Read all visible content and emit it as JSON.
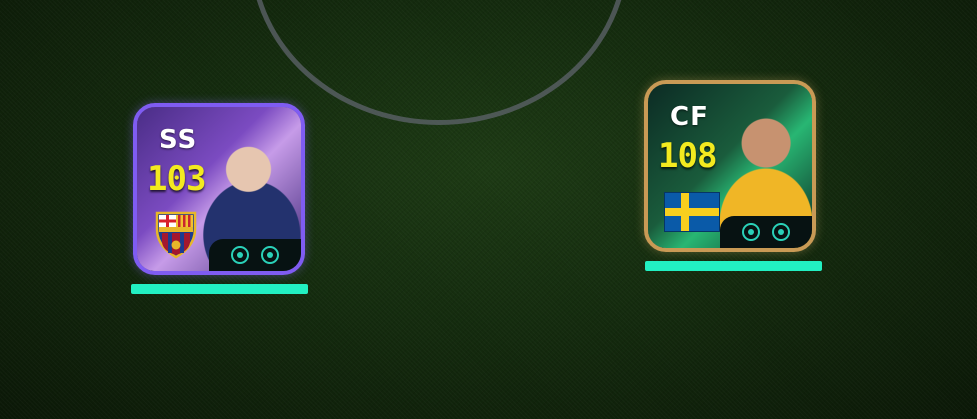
{
  "players": [
    {
      "position": "SS",
      "rating": "103",
      "badge_icon": "fc-barcelona-crest",
      "skills": [
        "skill-icon",
        "skill-icon"
      ],
      "stamina": 1.0,
      "frame_color": "#7f5cf2"
    },
    {
      "position": "CF",
      "rating": "108",
      "badge_icon": "sweden-flag",
      "skills": [
        "skill-icon",
        "skill-icon"
      ],
      "stamina": 1.0,
      "frame_color": "#c99a55"
    }
  ],
  "colors": {
    "pitch": "#142b0e",
    "center_line": "#5f646c",
    "rating": "#f3ea1f",
    "stamina": "#22f0c2"
  }
}
